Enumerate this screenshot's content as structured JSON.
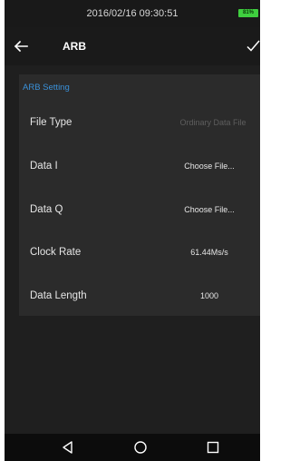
{
  "status_bar": {
    "datetime": "2016/02/16 09:30:51",
    "battery_label": "81%"
  },
  "app_bar": {
    "title": "ARB",
    "back_icon": "arrow-left-icon",
    "confirm_icon": "check-icon"
  },
  "arb_setting": {
    "section_title": "ARB Setting",
    "rows": [
      {
        "label": "File Type",
        "value": "Ordinary Data File"
      },
      {
        "label": "Data I",
        "value": "Choose File..."
      },
      {
        "label": "Data Q",
        "value": "Choose File..."
      },
      {
        "label": "Clock Rate",
        "value": "61.44Ms/s"
      },
      {
        "label": "Data Length",
        "value": "1000"
      }
    ]
  },
  "nav_bar": {
    "back_icon": "triangle-back-icon",
    "home_icon": "circle-home-icon",
    "recents_icon": "square-recents-icon"
  },
  "colors": {
    "background": "#1f1f1f",
    "panel": "#2b2b2b",
    "accent": "#3a90d8",
    "battery": "#3fcf3f",
    "disabled_text": "#5e5e5e"
  }
}
